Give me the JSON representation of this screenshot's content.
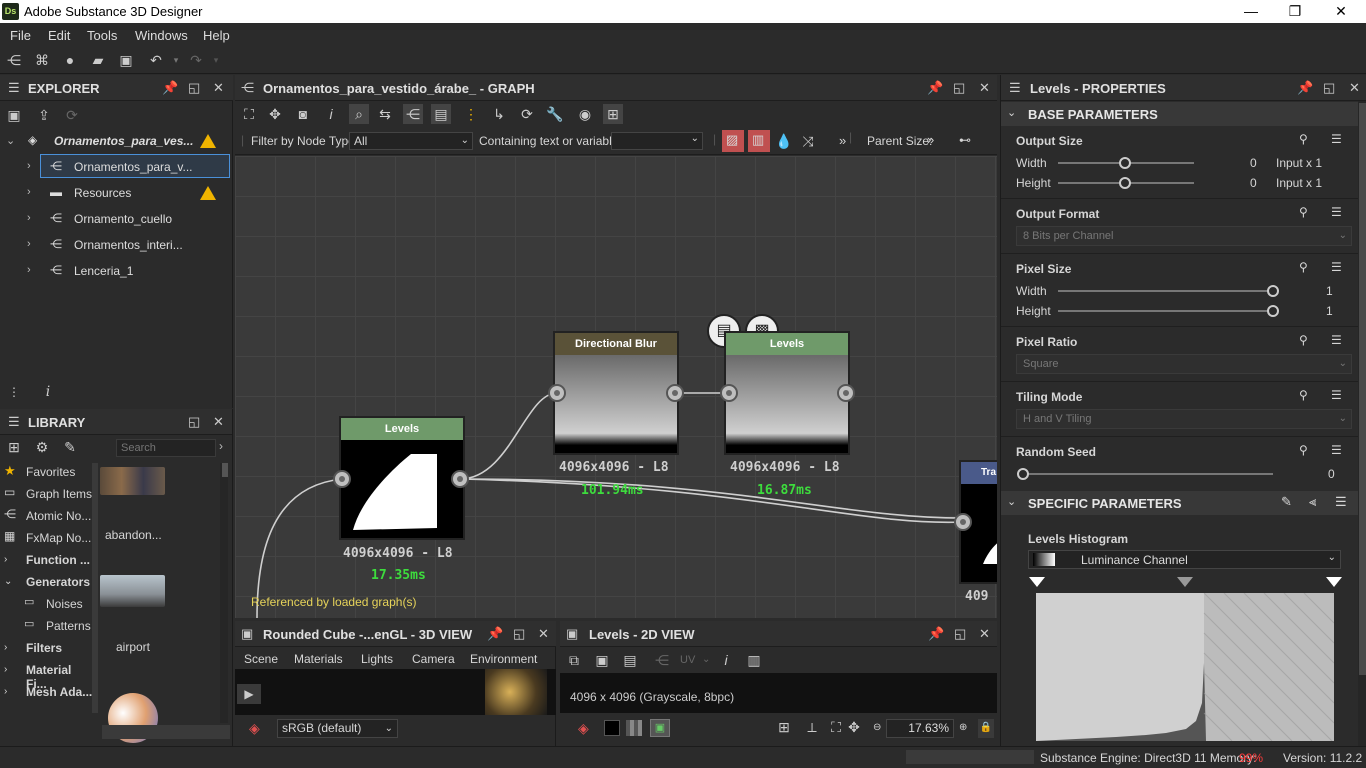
{
  "app": {
    "title": "Adobe Substance 3D Designer",
    "logo": "Ds"
  },
  "window_buttons": {
    "minimize": "—",
    "maximize": "❐",
    "close": "✕"
  },
  "menu": [
    "File",
    "Edit",
    "Tools",
    "Windows",
    "Help"
  ],
  "explorer": {
    "title": "EXPLORER",
    "root": "Ornamentos_para_ves...",
    "items": [
      {
        "label": "Ornamentos_para_v...",
        "selected": true
      },
      {
        "label": "Resources",
        "warning": true
      },
      {
        "label": "Ornamento_cuello"
      },
      {
        "label": "Ornamentos_interi..."
      },
      {
        "label": "Lenceria_1"
      }
    ]
  },
  "library": {
    "title": "LIBRARY",
    "search_placeholder": "Search",
    "categories": [
      {
        "label": "Favorites",
        "icon": "star-icon"
      },
      {
        "label": "Graph Items"
      },
      {
        "label": "Atomic No..."
      },
      {
        "label": "FxMap No..."
      },
      {
        "label": "Function ...",
        "bold": true
      },
      {
        "label": "Generators",
        "bold": true,
        "expanded": true
      },
      {
        "label": "Noises",
        "sub": true
      },
      {
        "label": "Patterns",
        "sub": true
      },
      {
        "label": "Filters",
        "bold": true
      },
      {
        "label": "Material Fi...",
        "bold": true
      },
      {
        "label": "Mesh Ada...",
        "bold": true
      }
    ],
    "thumbs": [
      {
        "label": "abandon..."
      },
      {
        "label": "airport"
      }
    ]
  },
  "graph": {
    "title": "Ornamentos_para_vestido_árabe_ - GRAPH",
    "filter_label": "Filter by Node Type",
    "filter_value": "All",
    "containing_label": "Containing text or variable",
    "parent_size": "Parent Size:",
    "more": "»",
    "referenced": "Referenced by loaded graph(s)",
    "nodes": [
      {
        "name": "Levels",
        "res": "4096x4096 - L8",
        "time": "17.35ms"
      },
      {
        "name": "Directional Blur",
        "res": "4096x4096 - L8",
        "time": "101.94ms"
      },
      {
        "name": "Levels",
        "res": "4096x4096 - L8",
        "time": "16.87ms"
      },
      {
        "name": "Tra",
        "res": "409"
      }
    ]
  },
  "view3d": {
    "title": "Rounded Cube -...enGL - 3D VIEW",
    "tabs": [
      "Scene",
      "Materials",
      "Lights",
      "Camera",
      "Environment"
    ],
    "colorspace": "sRGB (default)"
  },
  "view2d": {
    "title": "Levels - 2D VIEW",
    "info": "4096 x 4096 (Grayscale, 8bpc)",
    "uv": "UV",
    "zoom": "17.63%"
  },
  "properties": {
    "title": "Levels - PROPERTIES",
    "base_section": "BASE PARAMETERS",
    "output_size": {
      "label": "Output Size",
      "width_label": "Width",
      "height_label": "Height",
      "width_value": "0",
      "height_value": "0",
      "width_suffix": "Input x 1",
      "height_suffix": "Input x 1"
    },
    "output_format": {
      "label": "Output Format",
      "value": "8 Bits per Channel"
    },
    "pixel_size": {
      "label": "Pixel Size",
      "width_label": "Width",
      "height_label": "Height",
      "width_value": "1",
      "height_value": "1"
    },
    "pixel_ratio": {
      "label": "Pixel Ratio",
      "value": "Square"
    },
    "tiling_mode": {
      "label": "Tiling Mode",
      "value": "H and V Tiling"
    },
    "random_seed": {
      "label": "Random Seed",
      "value": "0"
    },
    "specific_section": "SPECIFIC PARAMETERS",
    "histogram": {
      "label": "Levels Histogram",
      "channel": "Luminance Channel"
    }
  },
  "status": {
    "engine": "Substance Engine: Direct3D 11  Memory:",
    "memory": "99%",
    "version": "Version: 11.2.2"
  },
  "colors": {
    "accent": "#4a90d9",
    "warning": "#f0b400",
    "green": "#3ddc3d",
    "memory": "#ff3b3b"
  }
}
